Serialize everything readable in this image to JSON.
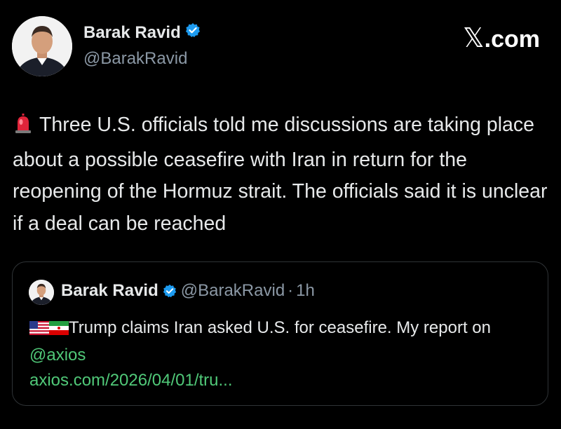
{
  "author": {
    "name": "Barak Ravid",
    "handle": "@BarakRavid"
  },
  "brand": {
    "logo_glyph": "𝕏",
    "logo_suffix": ".com"
  },
  "tweet": {
    "emoji": "siren-icon",
    "text": "Three U.S. officials told me discussions are taking place about a possible ceasefire with Iran in return for the reopening of the Hormuz strait. The officials said it is unclear if a deal can be reached"
  },
  "quote": {
    "name": "Barak Ravid",
    "handle": "@BarakRavid",
    "separator": "·",
    "time": "1h",
    "flags": [
      "us-flag-icon",
      "iran-flag-icon"
    ],
    "text": "Trump claims Iran asked U.S. for ceasefire. My report on ",
    "mention": "@axios",
    "link": "axios.com/2026/04/01/tru..."
  },
  "colors": {
    "background": "#000000",
    "text": "#e7e9ea",
    "secondary": "#8b98a5",
    "verified": "#1d9bf0",
    "link": "#50c878",
    "card_border": "#2f3336"
  }
}
